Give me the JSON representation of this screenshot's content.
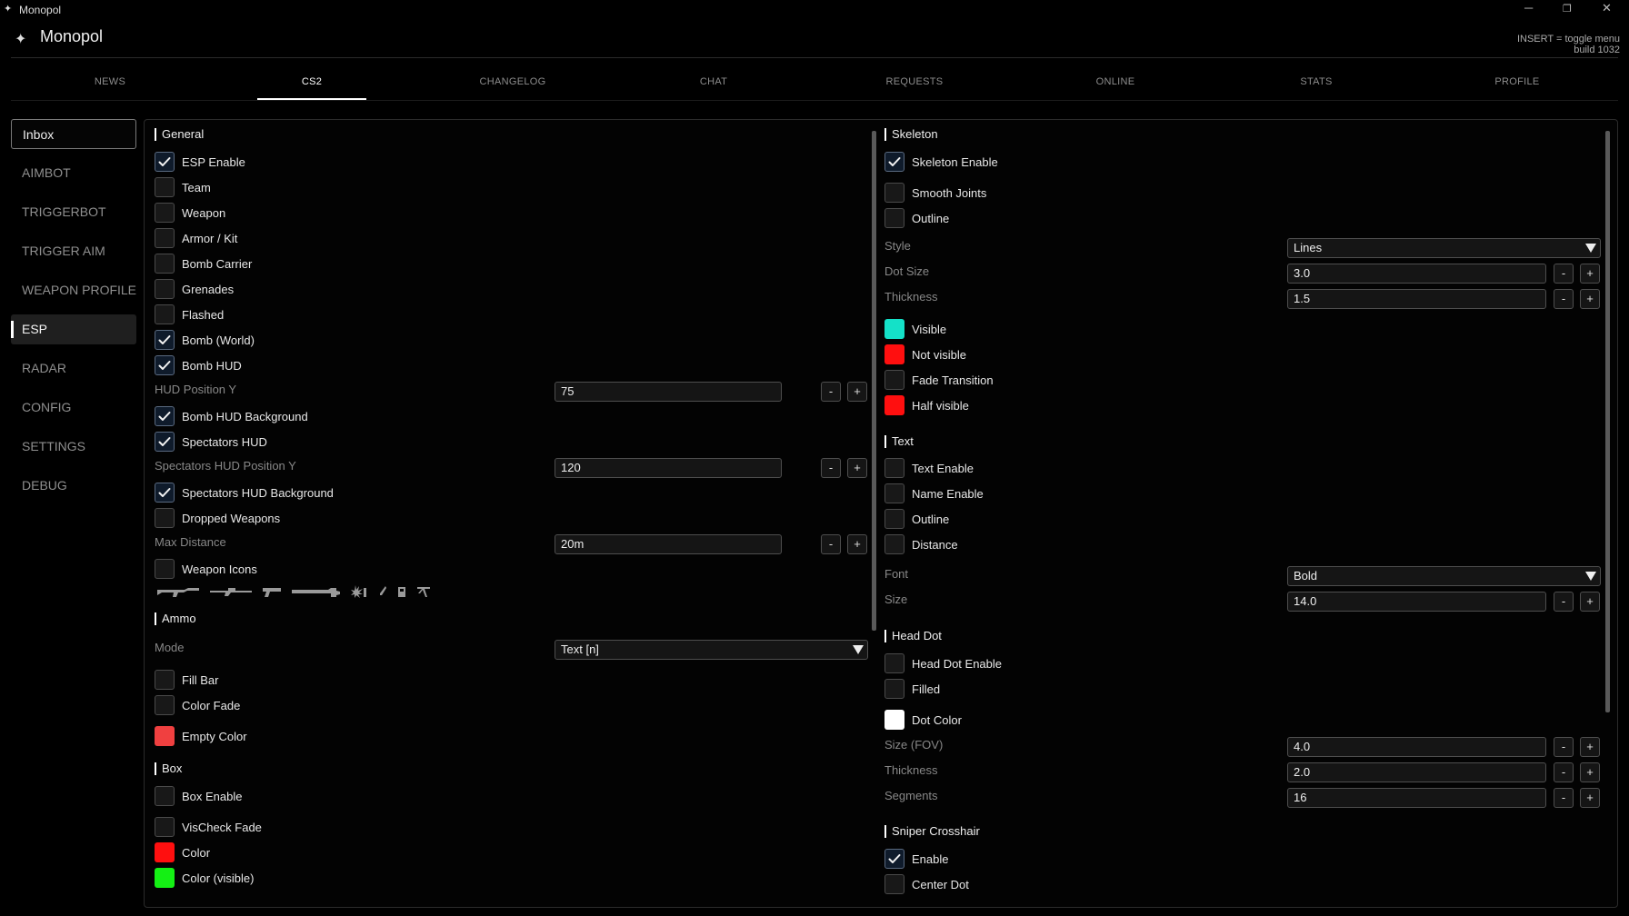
{
  "os": {
    "title": "Monopol",
    "logo_icon": "monopol-logo"
  },
  "app": {
    "title": "Monopol",
    "hint_line1": "INSERT = toggle menu",
    "hint_line2": "build 1032"
  },
  "tabs": [
    {
      "label": "NEWS"
    },
    {
      "label": "CS2"
    },
    {
      "label": "CHANGELOG"
    },
    {
      "label": "CHAT"
    },
    {
      "label": "REQUESTS"
    },
    {
      "label": "ONLINE"
    },
    {
      "label": "STATS"
    },
    {
      "label": "PROFILE"
    }
  ],
  "active_tab": "CS2",
  "sidebar": [
    {
      "label": "Inbox"
    },
    {
      "label": "AIMBOT"
    },
    {
      "label": "TRIGGERBOT"
    },
    {
      "label": "TRIGGER AIM"
    },
    {
      "label": "WEAPON PROFILES"
    },
    {
      "label": "ESP"
    },
    {
      "label": "RADAR"
    },
    {
      "label": "CONFIG"
    },
    {
      "label": "SETTINGS"
    },
    {
      "label": "DEBUG"
    }
  ],
  "active_sidebar": "ESP",
  "colors": {
    "accent": "#ffffff",
    "cyan": "#14e1c8",
    "red": "#ff0f0f",
    "empty_red": "#f04040",
    "green": "#14f014",
    "white": "#ffffff"
  },
  "left": {
    "general": {
      "title": "General",
      "items": [
        {
          "label": "ESP Enable",
          "checked": true
        },
        {
          "label": "Team",
          "checked": false
        },
        {
          "label": "Weapon",
          "checked": false
        },
        {
          "label": "Armor / Kit",
          "checked": false
        },
        {
          "label": "Bomb Carrier",
          "checked": false
        },
        {
          "label": "Grenades",
          "checked": false
        },
        {
          "label": "Flashed",
          "checked": false
        },
        {
          "label": "Bomb (World)",
          "checked": true
        },
        {
          "label": "Bomb HUD",
          "checked": true
        }
      ],
      "hud_pos_label": "HUD Position Y",
      "hud_pos_value": "75",
      "bomb_hud_bg": {
        "label": "Bomb HUD Background",
        "checked": true
      },
      "spectators_hud": {
        "label": "Spectators HUD",
        "checked": true
      },
      "spec_pos_label": "Spectators HUD Position Y",
      "spec_pos_value": "120",
      "spec_bg": {
        "label": "Spectators HUD Background",
        "checked": true
      },
      "dropped": {
        "label": "Dropped Weapons",
        "checked": false
      },
      "max_dist_label": "Max Distance",
      "max_dist_value": "20m",
      "weapon_icons": {
        "label": "Weapon Icons",
        "checked": false
      }
    },
    "ammo": {
      "title": "Ammo",
      "mode_label": "Mode",
      "mode_value": "Text [n]",
      "fill_bar": {
        "label": "Fill Bar",
        "checked": false
      },
      "color_fade": {
        "label": "Color Fade",
        "checked": false
      },
      "empty_color": {
        "label": "Empty Color"
      }
    },
    "box": {
      "title": "Box",
      "box_enable": {
        "label": "Box Enable",
        "checked": false
      },
      "vischeck": {
        "label": "VisCheck Fade",
        "checked": false
      },
      "color": {
        "label": "Color"
      },
      "color_visible": {
        "label": "Color (visible)"
      }
    }
  },
  "right": {
    "skeleton": {
      "title": "Skeleton",
      "enable": {
        "label": "Skeleton Enable",
        "checked": true
      },
      "smooth": {
        "label": "Smooth Joints",
        "checked": false
      },
      "outline": {
        "label": "Outline",
        "checked": false
      },
      "style_label": "Style",
      "style_value": "Lines",
      "dot_size_label": "Dot Size",
      "dot_size_value": "3.0",
      "thickness_label": "Thickness",
      "thickness_value": "1.5",
      "visible": {
        "label": "Visible"
      },
      "not_visible": {
        "label": "Not visible"
      },
      "fade": {
        "label": "Fade Transition",
        "checked": false
      },
      "half_visible": {
        "label": "Half visible"
      }
    },
    "text": {
      "title": "Text",
      "text_enable": {
        "label": "Text Enable",
        "checked": false
      },
      "name_enable": {
        "label": "Name Enable",
        "checked": false
      },
      "outline": {
        "label": "Outline",
        "checked": false
      },
      "distance": {
        "label": "Distance",
        "checked": false
      },
      "font_label": "Font",
      "font_value": "Bold",
      "size_label": "Size",
      "size_value": "14.0"
    },
    "head_dot": {
      "title": "Head Dot",
      "enable": {
        "label": "Head Dot Enable",
        "checked": false
      },
      "filled": {
        "label": "Filled",
        "checked": false
      },
      "dot_color": {
        "label": "Dot Color"
      },
      "size_label": "Size (FOV)",
      "size_value": "4.0",
      "thickness_label": "Thickness",
      "thickness_value": "2.0",
      "segments_label": "Segments",
      "segments_value": "16"
    },
    "sniper": {
      "title": "Sniper Crosshair",
      "enable": {
        "label": "Enable",
        "checked": true
      },
      "center_dot": {
        "label": "Center Dot",
        "checked": false
      }
    }
  },
  "stepper": {
    "minus": "-",
    "plus": "+"
  }
}
